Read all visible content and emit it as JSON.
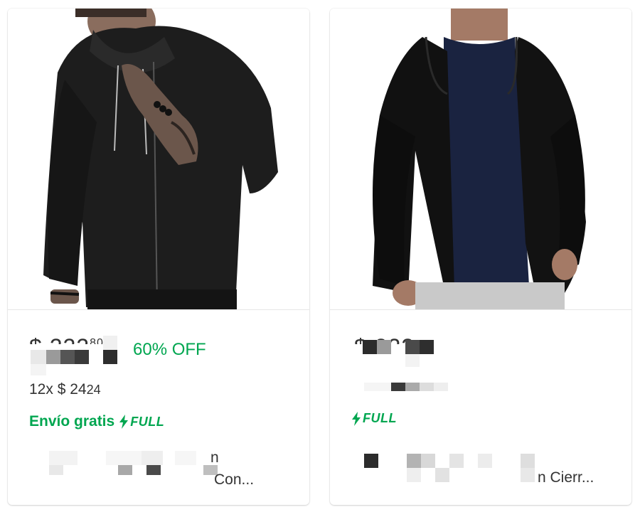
{
  "products": [
    {
      "image_desc": "man-black-zip-hoodie",
      "old_price": "$ 222",
      "old_price_cents": "80",
      "discount": "60% OFF",
      "installments_prefix": "12x",
      "installments_amount": "$ 24",
      "installments_cents": "24",
      "shipping": "Envío gratis",
      "full_label": "FULL",
      "title_line1_tail": "n",
      "title_line2_tail": "Con..."
    },
    {
      "image_desc": "man-open-black-hoodie-navy-tee",
      "old_price": "$ 222",
      "full_label": "FULL",
      "title_line2_tail": "n Cierr..."
    }
  ],
  "colors": {
    "accent_green": "#00a650",
    "text": "#333333"
  }
}
